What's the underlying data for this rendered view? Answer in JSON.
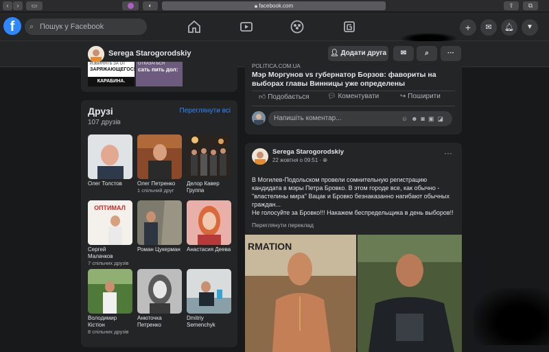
{
  "browser": {
    "url": "facebook.com"
  },
  "nav": {
    "search_placeholder": "Пошук у Facebook"
  },
  "profile": {
    "name": "Serega Starogorodskiy",
    "add_friend": "Додати друга"
  },
  "top_card": {
    "image_text_1": "ЗАРЯЖАЮЩЕГОСЯ",
    "image_text_2": "КАРАБИНА.",
    "image_text_3": "сать пить дол:",
    "image_text_top": "ИЗВИНЯТЬ ЗА ОТ",
    "image_text_top2": "ОТКАЗАТЬСЯ"
  },
  "friends": {
    "title": "Друзі",
    "count": "107 друзів",
    "see_all": "Переглянути всі",
    "items": [
      {
        "name": "Олег Толстов",
        "mutual": ""
      },
      {
        "name": "Олег Петренко",
        "mutual": "1 спільний друг"
      },
      {
        "name": "Делор Кавер Группа",
        "mutual": ""
      },
      {
        "name": "Сергей Малачков",
        "mutual": "7 спільних друзів"
      },
      {
        "name": "Роман Цукерман",
        "mutual": ""
      },
      {
        "name": "Анастасия Деева",
        "mutual": ""
      },
      {
        "name": "Володимир Кістіон",
        "mutual": "8 спільних друзів"
      },
      {
        "name": "Анюточка Петренко",
        "mutual": ""
      },
      {
        "name": "Dmitriy Semenchyk",
        "mutual": ""
      }
    ],
    "optimal_logo": "ОПТИМАЛ"
  },
  "shared_post": {
    "source": "POLITICA.COM.UA",
    "headline": "Мэр Моргунов vs губернатор Борзов: фавориты на выборах главы Винницы уже определены",
    "like": "Подобається",
    "comment": "Коментувати",
    "share": "Поширити",
    "comment_placeholder": "Напишіть коментар..."
  },
  "post": {
    "author": "Serega Starogorodskiy",
    "time": "22 жовтня о 09:51 · ",
    "text": "В Могилев-Подольском провели сомнительную регистрацию кандидата в мэры Петра Бровко. В этом городе все, как обычно - \"властелины мира\" Вацак и Бровко безнаказанно нагибают обычных граждан...\nНе голосуйте за Бровко!!! Накажем беспредельщика в день выборов!!",
    "translate": "Переглянути переклад",
    "image_text": "RMATION"
  }
}
